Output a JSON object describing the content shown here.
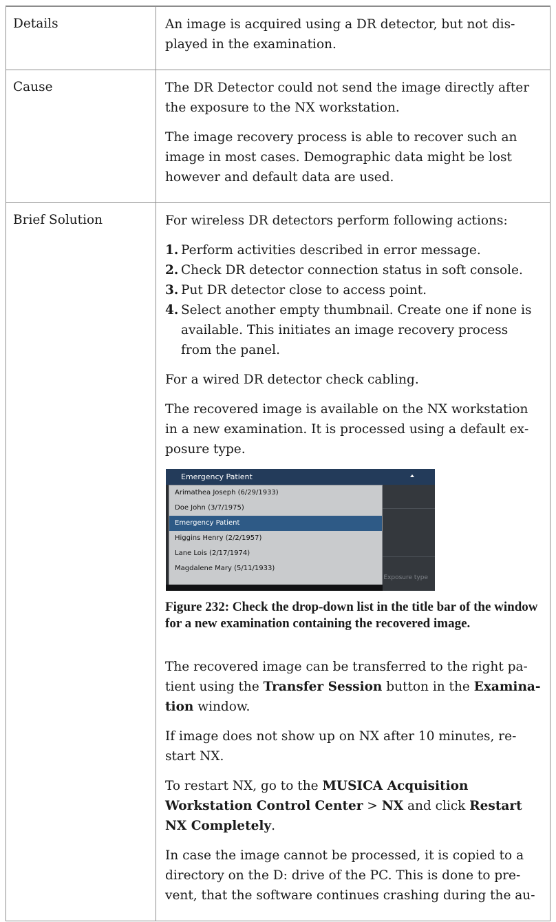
{
  "rows": {
    "details": {
      "label": "Details",
      "text": "An image is acquired using a DR detector, but not dis­played in the examination."
    },
    "cause": {
      "label": "Cause",
      "p1": "The DR Detector could not send the image directly after the exposure to the NX workstation.",
      "p2": "The image recovery process is able to recover such an im­age in most cases. Demographic data might be lost how­ever and default data are used."
    },
    "solution": {
      "label": "Brief Solution",
      "intro": "For wireless DR detectors perform following actions:",
      "steps": [
        {
          "num": "1.",
          "text": "Perform activities described in error message."
        },
        {
          "num": "2.",
          "text": "Check DR detector connection status in soft console."
        },
        {
          "num": "3.",
          "text": "Put DR detector close to access point."
        },
        {
          "num": "4.",
          "text": "Select another empty thumbnail. Create one if none is available. This initiates an image recovery process from the panel."
        }
      ],
      "wired": "For a wired DR detector check cabling.",
      "recovered": "The recovered image is available on the NX workstation in a new examination. It is processed using a default ex­posure type.",
      "figure": {
        "title": "Emergency Patient",
        "options": [
          "Arimathea Joseph (6/29/1933)",
          "Doe John (3/7/1975)",
          "Emergency Patient",
          "Higgins Henry (2/2/1957)",
          "Lane Lois (2/17/1974)",
          "Magdalene Mary (5/11/1933)"
        ],
        "selected_index": 2,
        "side_label": "Exposure type"
      },
      "caption": "Figure 232: Check the drop-down list in the title bar of the window for a new examination containing the recov­ered image.",
      "transfer": {
        "t1": "The recovered image can be transferred to the right pa­tient using the ",
        "b1": "Transfer Session",
        "t2": " button in the ",
        "b2": "Examina­tion",
        "t3": " window."
      },
      "no_show": "If image does not show up on NX after 10 minutes, re­start NX.",
      "restart": {
        "t1": "To restart NX, go to the ",
        "b1": "MUSICA Acquisition Workstation Control Center",
        "t2": " > ",
        "b2": "NX",
        "t3": " and click ",
        "b3": "Restart NX Com­pletely",
        "t4": "."
      },
      "cannot_process": "In case the image cannot be processed, it is copied to a directory on the D: drive of the PC. This is done to pre­vent, that the software continues crashing during the au-"
    }
  }
}
